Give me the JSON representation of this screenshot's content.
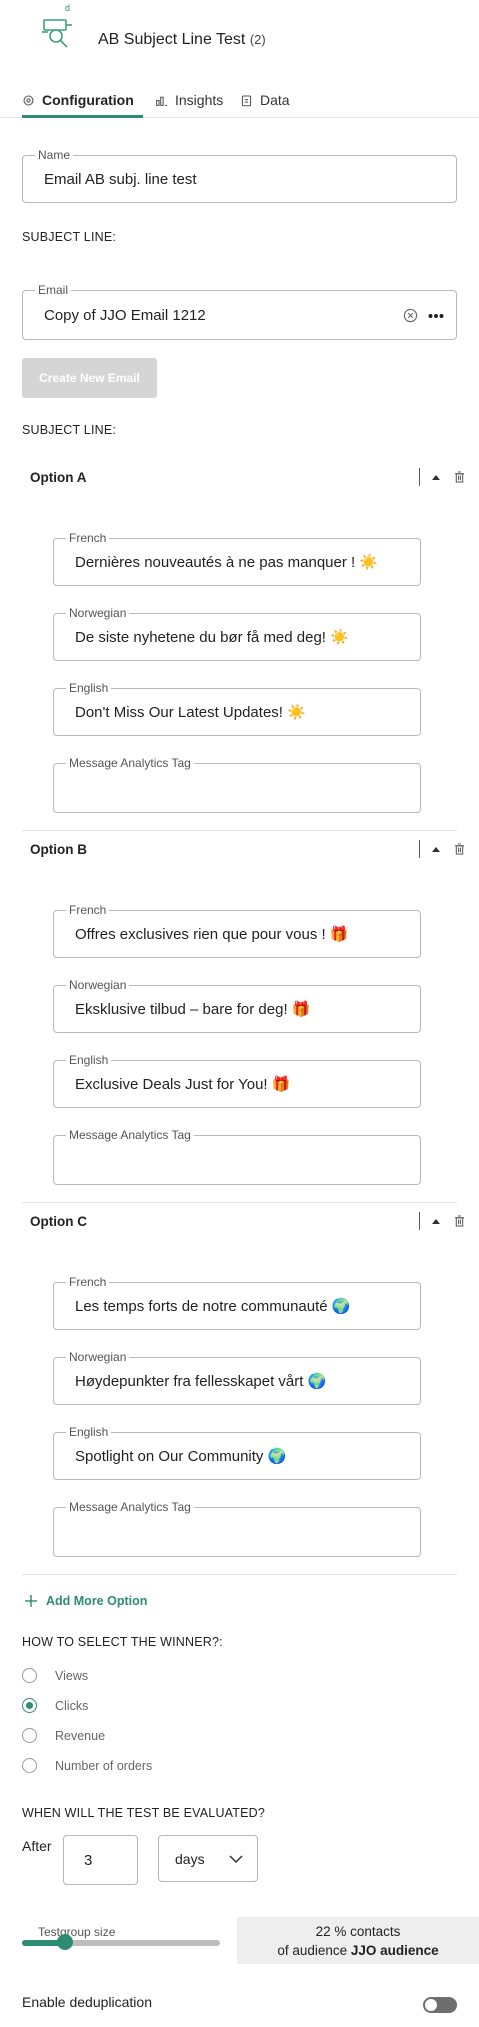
{
  "header": {
    "title": "AB Subject Line Test",
    "count": "(2)",
    "logo_letter": "d",
    "logo_icon": "ab-test-logo-icon"
  },
  "tabs": [
    {
      "label": "Configuration",
      "icon": "gear-icon",
      "active": true
    },
    {
      "label": "Insights",
      "icon": "bar-chart-icon",
      "active": false
    },
    {
      "label": "Data",
      "icon": "clipboard-icon",
      "active": false
    }
  ],
  "name_field": {
    "label": "Name",
    "value": "Email AB subj. line test"
  },
  "subject_line_label": "SUBJECT LINE:",
  "email_field": {
    "label": "Email",
    "value": "Copy of JJO Email 1212",
    "clear_icon": "clear-circle-icon",
    "more_icon": "more-dots-icon"
  },
  "create_button": "Create New Email",
  "subject_line_label_2": "SUBJECT LINE:",
  "options": [
    {
      "title": "Option A",
      "fields": [
        {
          "label": "French",
          "value": "Dernières nouveautés à ne pas manquer ! ☀️"
        },
        {
          "label": "Norwegian",
          "value": "De siste nyhetene du bør få med deg! ☀️"
        },
        {
          "label": "English",
          "value": "Don't Miss Our Latest Updates! ☀️"
        },
        {
          "label": "Message Analytics Tag",
          "value": ""
        }
      ]
    },
    {
      "title": "Option B",
      "fields": [
        {
          "label": "French",
          "value": "Offres exclusives rien que pour vous ! 🎁"
        },
        {
          "label": "Norwegian",
          "value": "Eksklusive tilbud – bare for deg! 🎁"
        },
        {
          "label": "English",
          "value": "Exclusive Deals Just for You! 🎁"
        },
        {
          "label": "Message Analytics Tag",
          "value": ""
        }
      ]
    },
    {
      "title": "Option C",
      "fields": [
        {
          "label": "French",
          "value": "Les temps forts de notre communauté 🌍"
        },
        {
          "label": "Norwegian",
          "value": "Høydepunkter fra fellesskapet vårt 🌍"
        },
        {
          "label": "English",
          "value": "Spotlight on Our Community 🌍"
        },
        {
          "label": "Message Analytics Tag",
          "value": ""
        }
      ]
    }
  ],
  "add_option_label": "Add More Option",
  "winner": {
    "heading": "HOW TO SELECT THE WINNER?:",
    "options": [
      "Views",
      "Clicks",
      "Revenue",
      "Number of orders"
    ],
    "selected": "Clicks"
  },
  "evaluation": {
    "heading": "WHEN WILL THE TEST BE EVALUATED?",
    "after_label": "After",
    "value": "3",
    "unit": "days"
  },
  "testgroup": {
    "label": "Testgroup size",
    "percent": 22,
    "percent_text": "22 % contacts",
    "audience_prefix": "of audience ",
    "audience_name": "JJO audience"
  },
  "dedup": {
    "label": "Enable deduplication",
    "enabled": false
  },
  "colors": {
    "accent": "#2e8b74",
    "border": "#b8b8b8",
    "disabled": "#d5d5d5"
  }
}
